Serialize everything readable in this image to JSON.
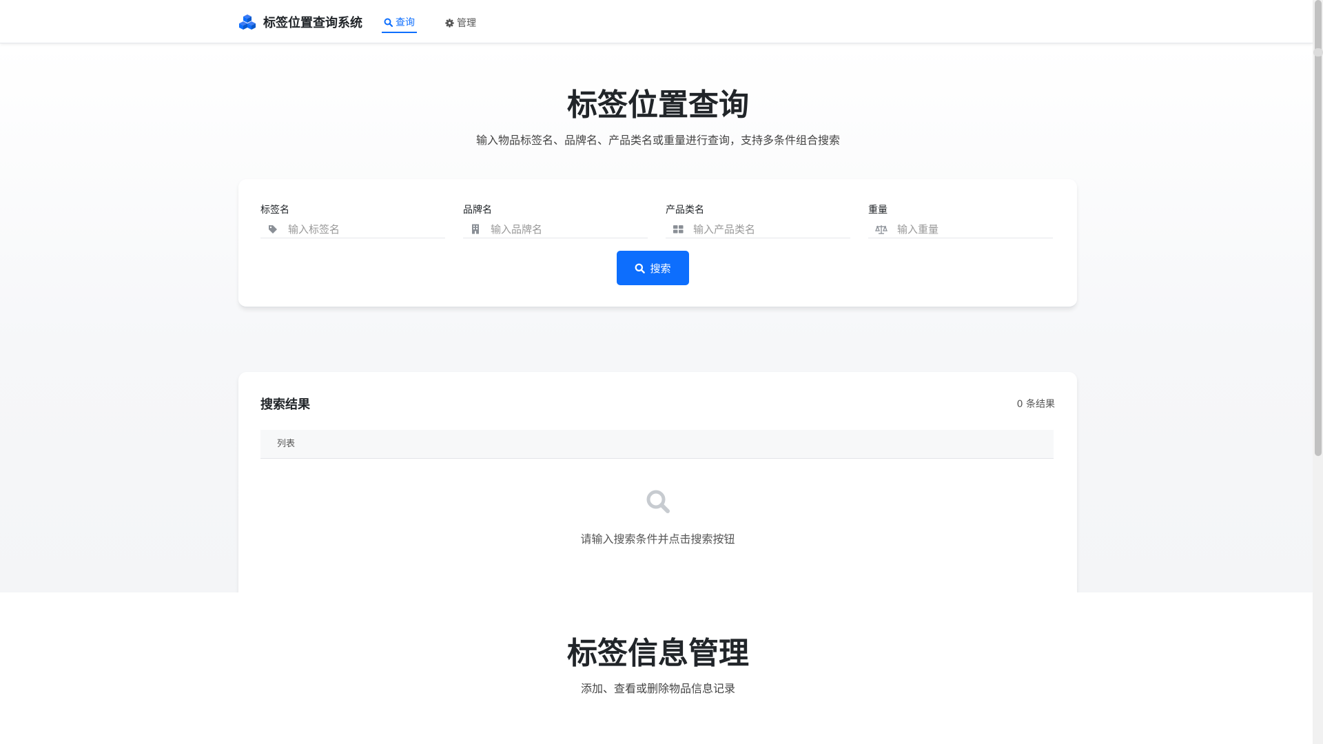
{
  "nav": {
    "brand_title": "标签位置查询系统",
    "items": [
      {
        "label": "查询",
        "icon": "search-icon",
        "active": true
      },
      {
        "label": "管理",
        "icon": "gear-icon",
        "active": false
      }
    ]
  },
  "search": {
    "title": "标签位置查询",
    "subtitle": "输入物品标签名、品牌名、产品类名或重量进行查询，支持多条件组合搜索",
    "fields": [
      {
        "label": "标签名",
        "placeholder": "输入标签名",
        "icon": "tag-icon",
        "value": ""
      },
      {
        "label": "品牌名",
        "placeholder": "输入品牌名",
        "icon": "building-icon",
        "value": ""
      },
      {
        "label": "产品类名",
        "placeholder": "输入产品类名",
        "icon": "grid-icon",
        "value": ""
      },
      {
        "label": "重量",
        "placeholder": "输入重量",
        "icon": "scale-icon",
        "value": ""
      }
    ],
    "button_label": "搜索"
  },
  "results": {
    "title": "搜索结果",
    "count_text": "0 条结果",
    "column_header": "列表",
    "empty_text": "请输入搜索条件并点击搜索按钮"
  },
  "manage": {
    "title": "标签信息管理",
    "subtitle": "添加、查看或删除物品信息记录"
  },
  "colors": {
    "accent": "#0d6efd",
    "text": "#212529",
    "muted": "#555555",
    "placeholder": "#999999"
  }
}
